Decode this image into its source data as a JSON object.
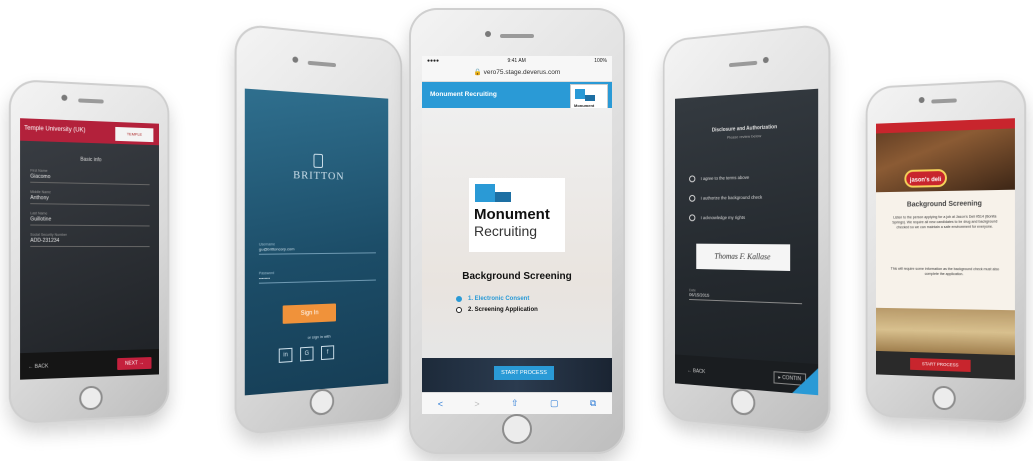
{
  "phone1": {
    "header_title": "Temple University (UK)",
    "logo_text": "TEMPLE",
    "section_title": "Basic info",
    "fields": [
      {
        "label": "First Name",
        "value": "Giacomo"
      },
      {
        "label": "Middle Name",
        "value": "Anthony"
      },
      {
        "label": "Last Name",
        "value": "Guillotine"
      },
      {
        "label": "Social Security Number",
        "value": "ADD-231234"
      }
    ],
    "back_label": "← BACK",
    "next_label": "NEXT →"
  },
  "phone2": {
    "brand": "BRITTON",
    "username_label": "Username",
    "username_value": "gu@brittoncorp.com",
    "password_label": "Password",
    "signin_label": "Sign In",
    "sso_label": "or sign in with",
    "social_buttons": [
      "in",
      "G",
      "f"
    ]
  },
  "phone3": {
    "status_time": "9:41 AM",
    "status_battery": "100%",
    "url": "🔒 vero75.stage.deverus.com",
    "app_title": "Monument Recruiting",
    "mini_logo_text": "Monument Recruiting",
    "logo_line1": "Monument",
    "logo_line2": "Recruiting",
    "heading": "Background Screening",
    "steps": [
      {
        "label": "1. Electronic Consent",
        "active": true
      },
      {
        "label": "2. Screening Application",
        "active": false
      }
    ],
    "start_label": "START PROCESS",
    "toolbar_icons": [
      "<",
      ">",
      "⇧",
      "▢",
      "⧉"
    ]
  },
  "phone4": {
    "heading": "Disclosure and Authorization",
    "subheading": "Please review below",
    "options": [
      "I agree to the terms above",
      "I authorize the background check",
      "I acknowledge my rights"
    ],
    "signature": "Thomas F. Kallase",
    "date_label": "Date",
    "date_value": "06/15/2015",
    "back_label": "← BACK",
    "continue_label": "▸ CONTIN"
  },
  "phone5": {
    "logo_text": "jason's deli",
    "title": "Background Screening",
    "para1": "Listen to the person applying for a job at Jason's Deli #514 (Bonita Springs). We require all new candidates to be drug and background checked so we can maintain a safe environment for everyone.",
    "para2": "This will require some information as the background check must also complete the application.",
    "start_label": "START PROCESS"
  }
}
